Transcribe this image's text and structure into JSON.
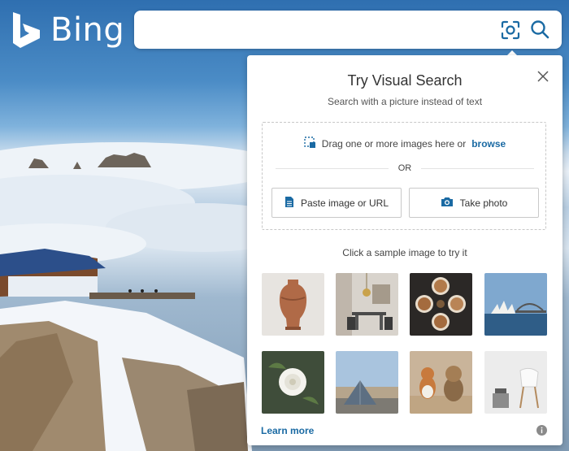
{
  "header": {
    "logo_text": "Bing",
    "search": {
      "value": "",
      "placeholder": ""
    },
    "icons": {
      "visual_search": "visual-search-icon",
      "search": "search-icon"
    }
  },
  "visual_search_panel": {
    "title": "Try Visual Search",
    "subtitle": "Search with a picture instead of text",
    "close_icon": "close-icon",
    "drop_zone": {
      "drag_text": "Drag one or more images here or",
      "browse_link": "browse",
      "or_text": "OR"
    },
    "buttons": {
      "paste": "Paste image or URL",
      "take_photo": "Take photo"
    },
    "sample_label": "Click a sample image to try it",
    "samples": [
      "vase",
      "dining-room",
      "coffee-cups",
      "opera-house",
      "white-rose",
      "louvre-pyramid",
      "dogs",
      "chair"
    ],
    "learn_more": "Learn more",
    "info_icon": "info-icon"
  },
  "colors": {
    "link": "#1a6aa3",
    "visual_search_icon": "#1a6aa3",
    "panel_bg": "#ffffff"
  }
}
